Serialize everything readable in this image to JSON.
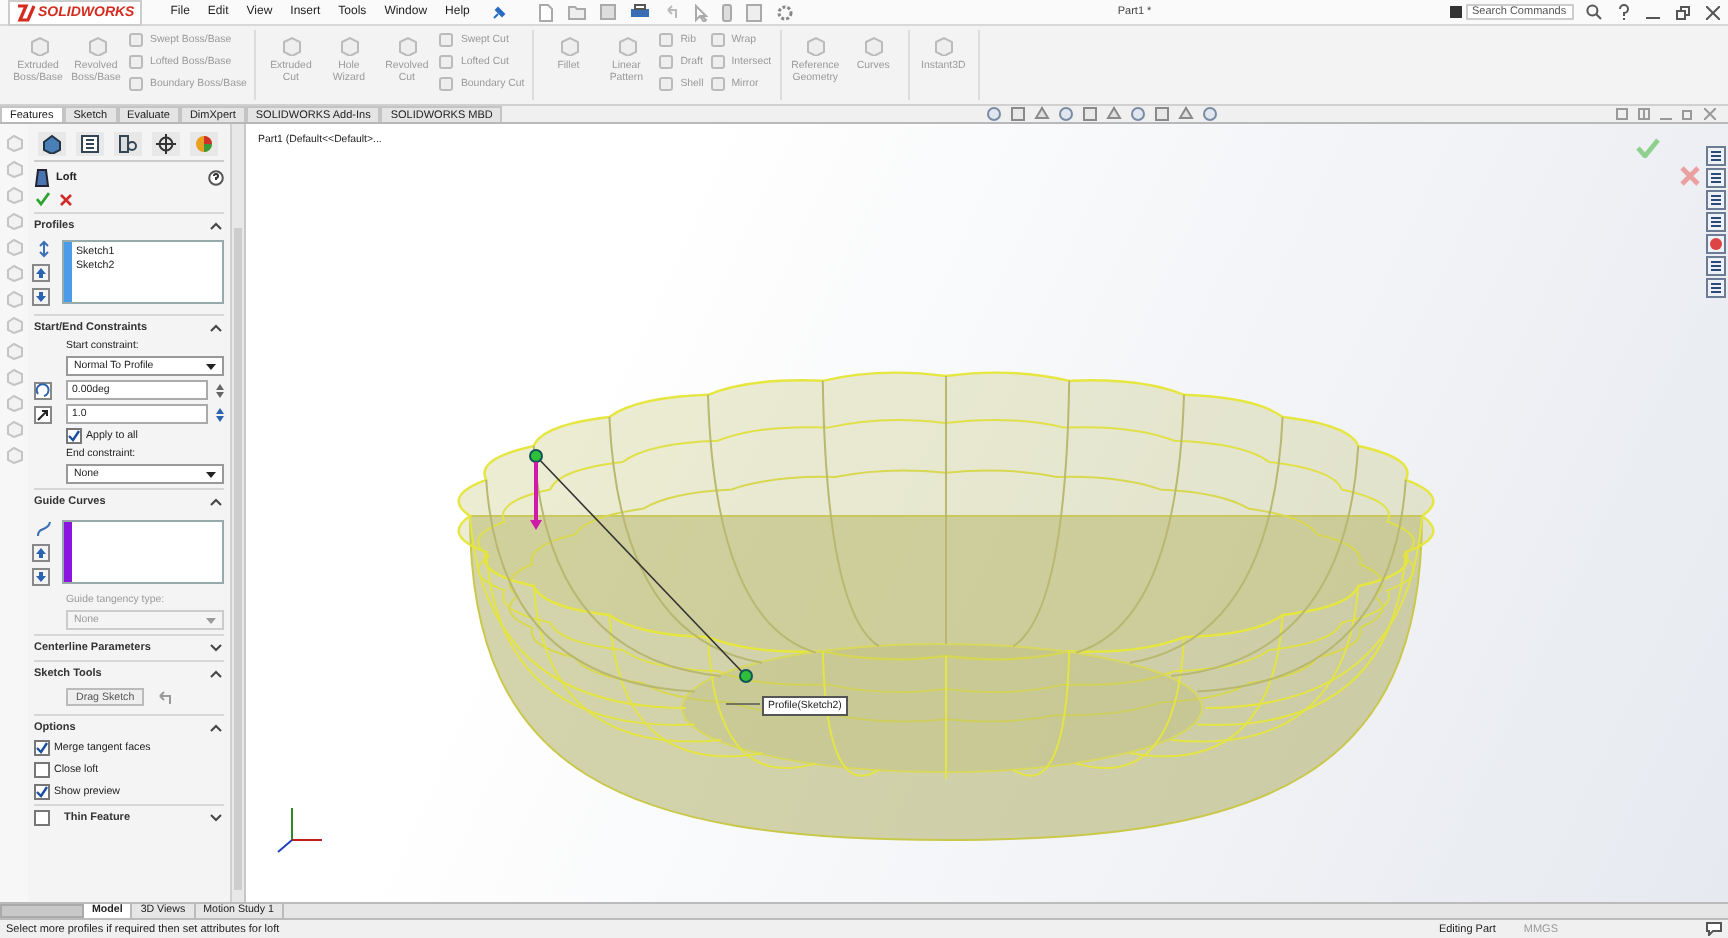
{
  "app": {
    "logo": "SOLIDWORKS",
    "menus": [
      "File",
      "Edit",
      "View",
      "Insert",
      "Tools",
      "Window",
      "Help"
    ],
    "title": "Part1 *",
    "search": {
      "placeholder": "Search Commands"
    }
  },
  "ribbon": {
    "groups": [
      {
        "items": [
          {
            "kind": "large",
            "label": "Extruded Boss/Base",
            "disabled": true
          },
          {
            "kind": "large",
            "label": "Revolved Boss/Base",
            "disabled": true
          },
          {
            "kind": "stack",
            "items": [
              {
                "label": "Swept Boss/Base",
                "disabled": true
              },
              {
                "label": "Lofted Boss/Base",
                "disabled": true
              },
              {
                "label": "Boundary Boss/Base",
                "disabled": true
              }
            ]
          }
        ]
      },
      {
        "items": [
          {
            "kind": "large",
            "label": "Extruded Cut",
            "disabled": true
          },
          {
            "kind": "large",
            "label": "Hole Wizard",
            "disabled": true
          },
          {
            "kind": "large",
            "label": "Revolved Cut",
            "disabled": true
          },
          {
            "kind": "stack",
            "items": [
              {
                "label": "Swept Cut",
                "disabled": true
              },
              {
                "label": "Lofted Cut",
                "disabled": true
              },
              {
                "label": "Boundary Cut",
                "disabled": true
              }
            ]
          }
        ]
      },
      {
        "items": [
          {
            "kind": "large",
            "label": "Fillet",
            "disabled": true
          },
          {
            "kind": "large",
            "label": "Linear Pattern",
            "disabled": true
          },
          {
            "kind": "stack",
            "items": [
              {
                "label": "Rib",
                "disabled": true
              },
              {
                "label": "Draft",
                "disabled": true
              },
              {
                "label": "Shell",
                "disabled": true
              }
            ]
          },
          {
            "kind": "stack",
            "items": [
              {
                "label": "Wrap",
                "disabled": true
              },
              {
                "label": "Intersect",
                "disabled": true
              },
              {
                "label": "Mirror",
                "disabled": true
              }
            ]
          }
        ]
      },
      {
        "items": [
          {
            "kind": "large",
            "label": "Reference Geometry",
            "disabled": true
          },
          {
            "kind": "large",
            "label": "Curves",
            "disabled": true
          }
        ]
      },
      {
        "items": [
          {
            "kind": "large",
            "label": "Instant3D",
            "disabled": true
          }
        ]
      }
    ]
  },
  "tabs": [
    {
      "label": "Features",
      "selected": true
    },
    {
      "label": "Sketch",
      "selected": false
    },
    {
      "label": "Evaluate",
      "selected": false
    },
    {
      "label": "DimXpert",
      "selected": false
    },
    {
      "label": "SOLIDWORKS Add-Ins",
      "selected": false
    },
    {
      "label": "SOLIDWORKS MBD",
      "selected": false
    }
  ],
  "property_manager": {
    "title": "Loft",
    "sections": [
      {
        "kind": "profiles",
        "title": "Profiles",
        "expanded": true,
        "items": [
          "Sketch1",
          "Sketch2"
        ]
      },
      {
        "kind": "constraints",
        "title": "Start/End Constraints",
        "expanded": true,
        "start_label": "Start constraint:",
        "start_value": "Normal To Profile",
        "angle": "0.00deg",
        "length": "1.0",
        "apply_all": {
          "label": "Apply to all",
          "checked": true
        },
        "end_label": "End constraint:",
        "end_value": "None"
      },
      {
        "kind": "guides",
        "title": "Guide Curves",
        "expanded": true,
        "tangency_label": "Guide tangency type:",
        "tangency_value": "None",
        "disabled": true
      },
      {
        "kind": "plain",
        "title": "Centerline Parameters",
        "expanded": false
      },
      {
        "kind": "sketch_tools",
        "title": "Sketch Tools",
        "expanded": true,
        "button": "Drag Sketch"
      },
      {
        "kind": "options",
        "title": "Options",
        "expanded": true,
        "checkboxes": [
          {
            "label": "Merge tangent faces",
            "checked": true
          },
          {
            "label": "Close loft",
            "checked": false
          },
          {
            "label": "Show preview",
            "checked": true
          }
        ]
      },
      {
        "kind": "thin",
        "title": "Thin Feature",
        "expanded": false,
        "checked": false
      }
    ]
  },
  "viewport": {
    "breadcrumb": "Part1 (Default<<Default>...",
    "callout": "Profile(Sketch2)"
  },
  "bottom_tabs": [
    {
      "label": "Model",
      "selected": true
    },
    {
      "label": "3D Views",
      "selected": false
    },
    {
      "label": "Motion Study 1",
      "selected": false
    }
  ],
  "status_bar": {
    "message": "Select more profiles if required then set attributes for loft",
    "mode": "Editing Part",
    "units": "MMGS"
  }
}
